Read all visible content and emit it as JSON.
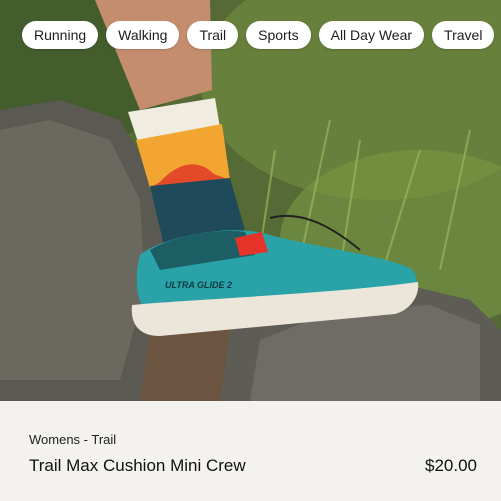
{
  "chips": [
    {
      "label": "Running"
    },
    {
      "label": "Walking"
    },
    {
      "label": "Trail"
    },
    {
      "label": "Sports"
    },
    {
      "label": "All Day Wear"
    },
    {
      "label": "Travel"
    }
  ],
  "product": {
    "subtitle": "Womens - Trail",
    "title": "Trail Max Cushion Mini Crew",
    "price": "$20.00"
  },
  "image": {
    "shoe_label": "ULTRA GLIDE 2"
  },
  "colors": {
    "chip_bg": "#ffffff",
    "info_bg": "#f4f2ef",
    "shoe_teal": "#2aa3a8",
    "sock_orange": "#f2a531",
    "sock_navy": "#1f4a5a"
  }
}
